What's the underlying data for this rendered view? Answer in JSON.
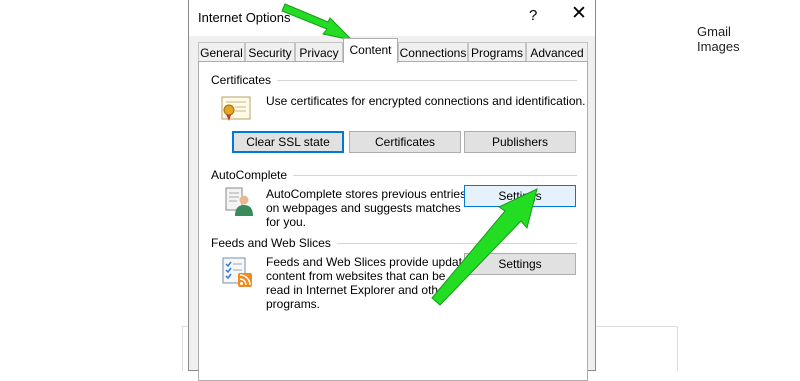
{
  "background": {
    "links": [
      "Gmail",
      "Images"
    ]
  },
  "dialog": {
    "title": "Internet Options",
    "help_glyph": "?",
    "close_glyph": "✕",
    "tabs": [
      "General",
      "Security",
      "Privacy",
      "Content",
      "Connections",
      "Programs",
      "Advanced"
    ],
    "active_tab": "Content",
    "certificates": {
      "label": "Certificates",
      "description": "Use certificates for encrypted connections and identification.",
      "buttons": [
        "Clear SSL state",
        "Certificates",
        "Publishers"
      ]
    },
    "autocomplete": {
      "label": "AutoComplete",
      "description_lines": [
        "AutoComplete stores previous entries",
        "on webpages and suggests matches",
        "for you."
      ],
      "button": "Settings"
    },
    "feeds": {
      "label": "Feeds and Web Slices",
      "description_lines": [
        "Feeds and Web Slices provide updated",
        "content from websites that can be",
        "read in Internet Explorer and other",
        "programs."
      ],
      "button": "Settings"
    }
  },
  "annotations": {
    "arrow_color": "#22dd22",
    "arrow_outline": "#1a9a1a"
  }
}
